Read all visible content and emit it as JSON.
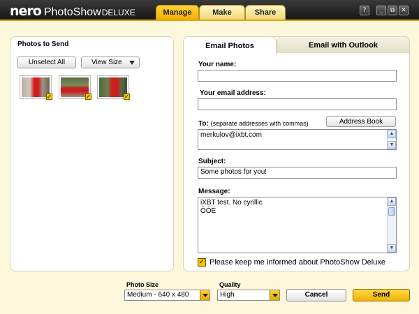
{
  "app": {
    "logo_nero": "nero",
    "logo_product": "PhotoShow",
    "logo_edition": "DELUXE"
  },
  "main_tabs": [
    {
      "label": "Manage",
      "active": true
    },
    {
      "label": "Make",
      "active": false
    },
    {
      "label": "Share",
      "active": false
    }
  ],
  "window_buttons": {
    "help": "?",
    "minimize": "_",
    "restore": "⧉",
    "close": "✕"
  },
  "left_panel": {
    "title": "Photos to Send",
    "unselect_all": "Unselect All",
    "view_size": "View Size",
    "thumbnails": [
      {
        "checked": true
      },
      {
        "checked": true
      },
      {
        "checked": true
      }
    ]
  },
  "tabs": [
    {
      "label": "Email Photos",
      "active": true
    },
    {
      "label": "Email with Outlook",
      "active": false
    }
  ],
  "form": {
    "your_name_label": "Your name:",
    "your_name_value": "",
    "email_label": "Your email address:",
    "email_value": "",
    "to_label": "To:",
    "to_hint": "(separate addresses with commas)",
    "address_book": "Address Book",
    "to_value": "merkulov@ixbt.com",
    "subject_label": "Subject:",
    "subject_value": "Some photos for you!",
    "message_label": "Message:",
    "message_value": "iXBT test. No cyrillic\nÔÓÉ",
    "keep_informed": "Please keep me informed about PhotoShow Deluxe",
    "keep_informed_checked": true
  },
  "bottom": {
    "photo_size_label": "Photo Size",
    "photo_size_value": "Medium - 640 x 480",
    "quality_label": "Quality",
    "quality_value": "High",
    "cancel": "Cancel",
    "send": "Send"
  },
  "colors": {
    "accent": "#f7c200",
    "background": "#fdf7dc",
    "titlebar": "#1e1e1e"
  }
}
